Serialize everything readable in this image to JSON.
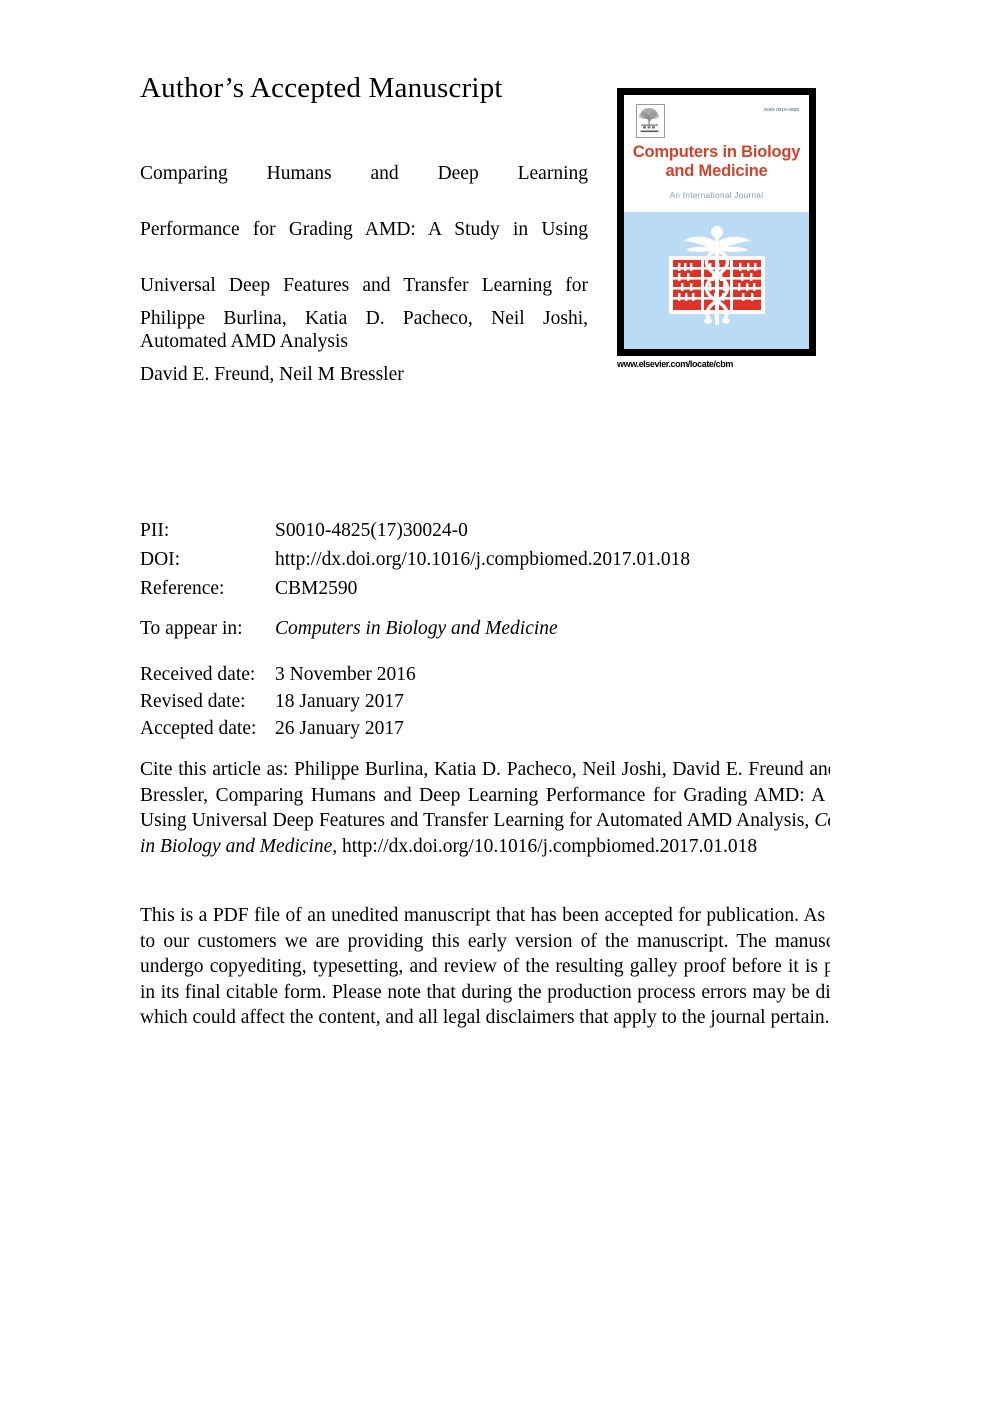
{
  "document": {
    "heading": "Author’s Accepted Manuscript",
    "article_title_lines": [
      "Comparing Humans and Deep Learning",
      "Performance for Grading AMD: A Study in Using",
      "Universal Deep Features and Transfer Learning for",
      "Automated AMD Analysis"
    ],
    "authors_lines": [
      "Philippe Burlina, Katia D. Pacheco, Neil Joshi,",
      "David E. Freund, Neil M Bressler"
    ]
  },
  "cover": {
    "issn": "ISSN 0010-4825",
    "title_line1": "Computers in Biology",
    "title_line2": "and Medicine",
    "subtitle": "An International Journal",
    "url": "www.elsevier.com/locate/cbm",
    "publisher_logo": "elsevier-tree-logo",
    "emblem": "caduceus-abacus-emblem",
    "colors": {
      "title_red": "#d0442d",
      "panel_blue": "#b9dcf4",
      "abacus_red": "#e03127",
      "subtitle_blue": "#7f9fb5",
      "border_black": "#000000"
    }
  },
  "metadata": {
    "pii_label": "PII:",
    "pii_value": "S0010-4825(17)30024-0",
    "doi_label": "DOI:",
    "doi_value": "http://dx.doi.org/10.1016/j.compbiomed.2017.01.018",
    "reference_label": "Reference:",
    "reference_value": "CBM2590"
  },
  "appear": {
    "label": "To appear in:",
    "value": "Computers in Biology and Medicine"
  },
  "dates": {
    "received_label": "Received date:",
    "received_value": "3 November 2016",
    "revised_label": "Revised date:",
    "revised_value": "18 January 2017",
    "accepted_label": "Accepted date:",
    "accepted_value": "26 January 2017"
  },
  "citation": {
    "prefix": "Cite this article as: Philippe Burlina, Katia D. Pacheco, Neil Joshi, David E. Freund and Neil M Bressler, Comparing Humans and Deep Learning Performance for Grading AMD: A Study in Using Universal Deep Features and Transfer Learning for Automated AMD Analysis, ",
    "journal": "Computers in Biology and Medicine",
    "suffix": ", http://dx.doi.org/10.1016/j.compbiomed.2017.01.018"
  },
  "disclaimer": {
    "text": "This is a PDF file of an unedited manuscript that has been accepted for publication. As a service to our customers we are providing this early version of the manuscript. The manuscript will undergo copyediting, typesetting, and review of the resulting galley proof before it is published in its final citable form. Please note that during the production process errors may be discovered which could affect the content, and all legal disclaimers that apply to the journal pertain."
  }
}
